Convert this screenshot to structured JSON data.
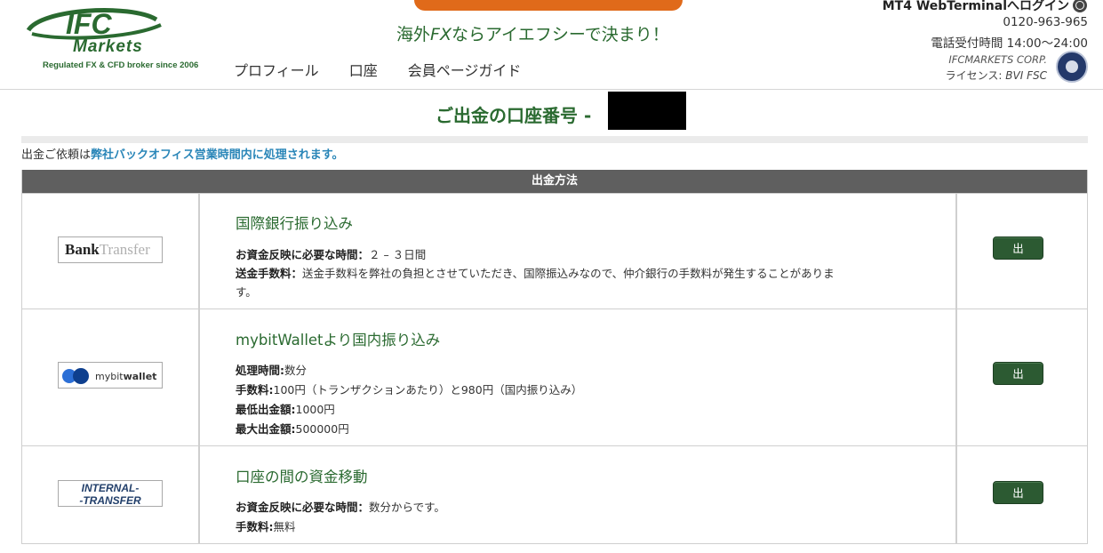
{
  "header": {
    "logo_text": "IFC",
    "logo_markets": "Markets",
    "logo_tagline": "Regulated FX & CFD broker since 2006",
    "tagline_prefix": "海外",
    "tagline_fx": "FX",
    "tagline_suffix": "ならアイエフシーで決まり！",
    "nav": [
      "プロフィール",
      "口座",
      "会員ページガイド"
    ],
    "login_label": "MT4 WebTerminalへログイン",
    "phone": "0120-963-965",
    "hours": "電話受付時間 14:00〜24:00",
    "corp": "IFCMARKETS CORP.",
    "license_prefix": "ライセンス: ",
    "license_value": "BVI FSC"
  },
  "page": {
    "title": "ご出金の口座番号 - ",
    "notice_prefix": "出金ご依頼は",
    "notice_highlight": "弊社バックオフィス営業時間内に処理されます。"
  },
  "table": {
    "header": "出金方法",
    "rows": [
      {
        "logo": {
          "bold": "Bank",
          "light": "Transfer"
        },
        "title": "国際銀行振り込み",
        "lines": [
          {
            "label": "お資金反映に必要な時間：",
            "value": "２ – ３日間"
          },
          {
            "label": "送金手数料：",
            "value": "送金手数料を弊社の負担とさせていただき、国際振込みなので、仲介銀行の手数料が発生することがありま"
          },
          {
            "label": "",
            "value": "す。"
          }
        ],
        "button": "出"
      },
      {
        "logo": {
          "light": "mybit",
          "bold": "wallet"
        },
        "title": "mybitWalletより国内振り込み",
        "lines": [
          {
            "label": "処理時間:",
            "value": "数分"
          },
          {
            "label": "手数料:",
            "value": "100円（トランザクションあたり）と980円（国内振り込み）"
          },
          {
            "label": "最低出金額:",
            "value": "1000円"
          },
          {
            "label": "最大出金額:",
            "value": "500000円"
          }
        ],
        "button": "出"
      },
      {
        "logo": {
          "line1": "INTERNAL-",
          "line2": "-TRANSFER"
        },
        "title": "口座の間の資金移動",
        "lines": [
          {
            "label": "お資金反映に必要な時間：",
            "value": "数分からです。"
          },
          {
            "label": "手数料:",
            "value": "無料"
          }
        ],
        "button": "出"
      }
    ]
  },
  "colors": {
    "brand_green": "#2a6a30",
    "accent_orange": "#e06a1a",
    "header_grey": "#5f5f5f",
    "notice_blue": "#2a86b8",
    "button_green": "#2c5a32"
  }
}
